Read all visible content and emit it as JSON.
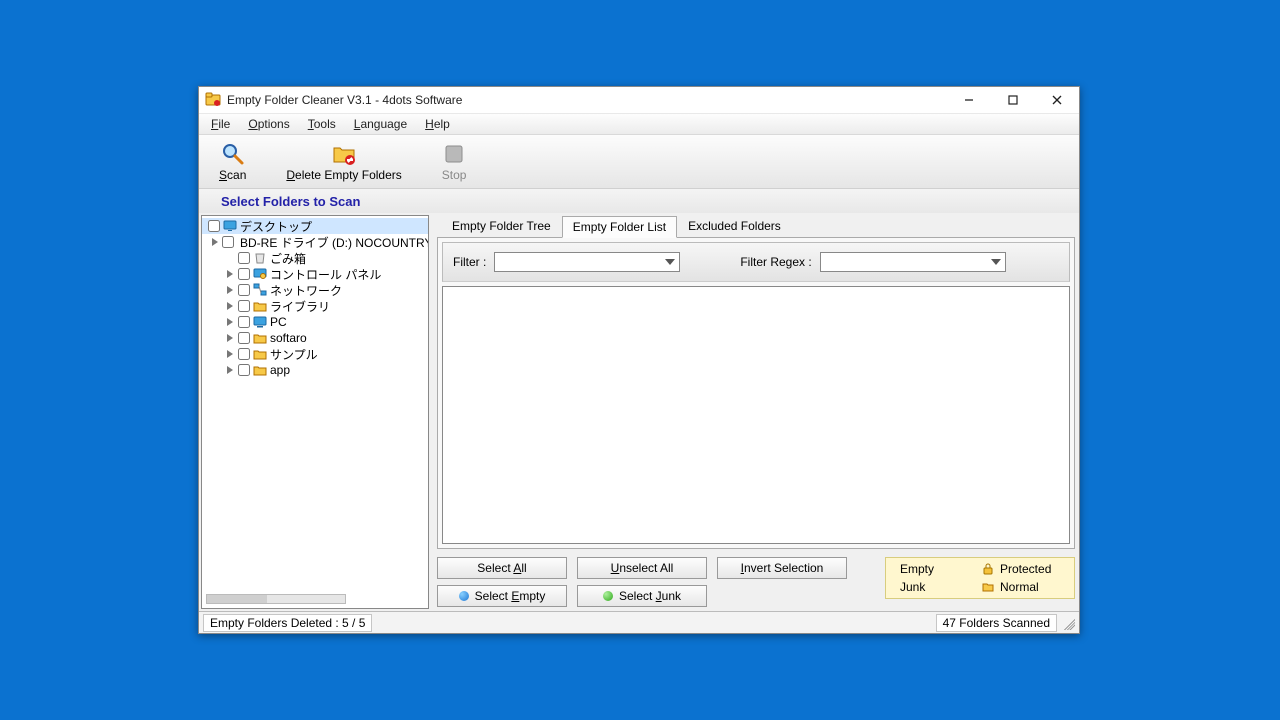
{
  "title": "Empty Folder Cleaner V3.1 - 4dots Software",
  "menus": {
    "file": "File",
    "options": "Options",
    "tools": "Tools",
    "language": "Language",
    "help": "Help"
  },
  "toolbar": {
    "scan": "Scan",
    "delete": "Delete Empty Folders",
    "stop": "Stop"
  },
  "heading": "Select Folders to Scan",
  "tree": [
    {
      "label": "デスクトップ",
      "icon": "desktop",
      "expander": false,
      "selected": true,
      "indent": 0
    },
    {
      "label": "BD-RE ドライブ (D:) NOCOUNTRY",
      "icon": "disc",
      "expander": true,
      "indent": 1
    },
    {
      "label": "ごみ箱",
      "icon": "recycle",
      "expander": false,
      "indent": 1
    },
    {
      "label": "コントロール パネル",
      "icon": "control",
      "expander": true,
      "indent": 1
    },
    {
      "label": "ネットワーク",
      "icon": "network",
      "expander": true,
      "indent": 1
    },
    {
      "label": "ライブラリ",
      "icon": "folder",
      "expander": true,
      "indent": 1
    },
    {
      "label": "PC",
      "icon": "pc",
      "expander": true,
      "indent": 1
    },
    {
      "label": "softaro",
      "icon": "folder",
      "expander": true,
      "indent": 1
    },
    {
      "label": "サンプル",
      "icon": "folder",
      "expander": true,
      "indent": 1
    },
    {
      "label": "app",
      "icon": "folder",
      "expander": true,
      "indent": 1
    }
  ],
  "tabs": {
    "tree": "Empty Folder Tree",
    "list": "Empty Folder List",
    "excluded": "Excluded Folders",
    "active": "list"
  },
  "filters": {
    "filter_label": "Filter :",
    "regex_label": "Filter Regex :",
    "filter_value": "",
    "regex_value": ""
  },
  "buttons": {
    "select_all": "Select All",
    "unselect_all": "Unselect All",
    "invert": "Invert Selection",
    "select_empty": "Select Empty",
    "select_junk": "Select Junk"
  },
  "legend": {
    "empty": "Empty",
    "protected": "Protected",
    "junk": "Junk",
    "normal": "Normal"
  },
  "status": {
    "left": "Empty Folders Deleted : 5 / 5",
    "right": "47 Folders Scanned"
  }
}
